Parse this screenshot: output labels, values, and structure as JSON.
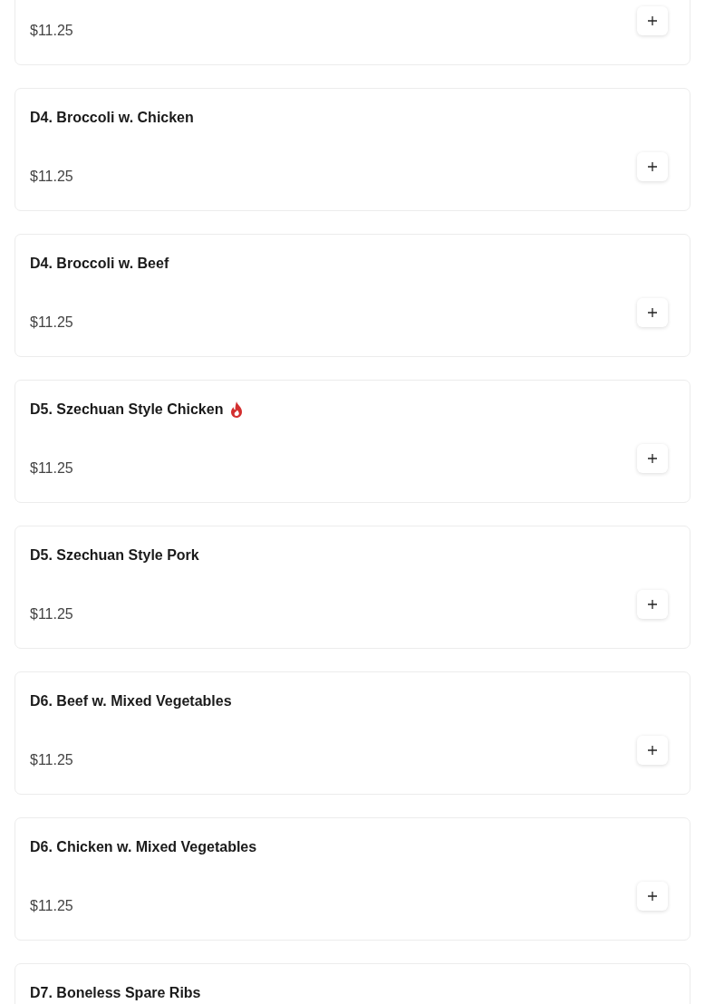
{
  "items": [
    {
      "price": "$11.25",
      "spicy": false
    },
    {
      "name": "D4. Broccoli w. Chicken",
      "price": "$11.25",
      "spicy": false
    },
    {
      "name": "D4. Broccoli w. Beef",
      "price": "$11.25",
      "spicy": false
    },
    {
      "name": "D5. Szechuan Style Chicken",
      "price": "$11.25",
      "spicy": true
    },
    {
      "name": "D5. Szechuan Style Pork",
      "price": "$11.25",
      "spicy": false
    },
    {
      "name": "D6. Beef w. Mixed Vegetables",
      "price": "$11.25",
      "spicy": false
    },
    {
      "name": "D6. Chicken w. Mixed Vegetables",
      "price": "$11.25",
      "spicy": false
    },
    {
      "name": "D7. Boneless Spare Ribs",
      "spicy": false
    }
  ]
}
